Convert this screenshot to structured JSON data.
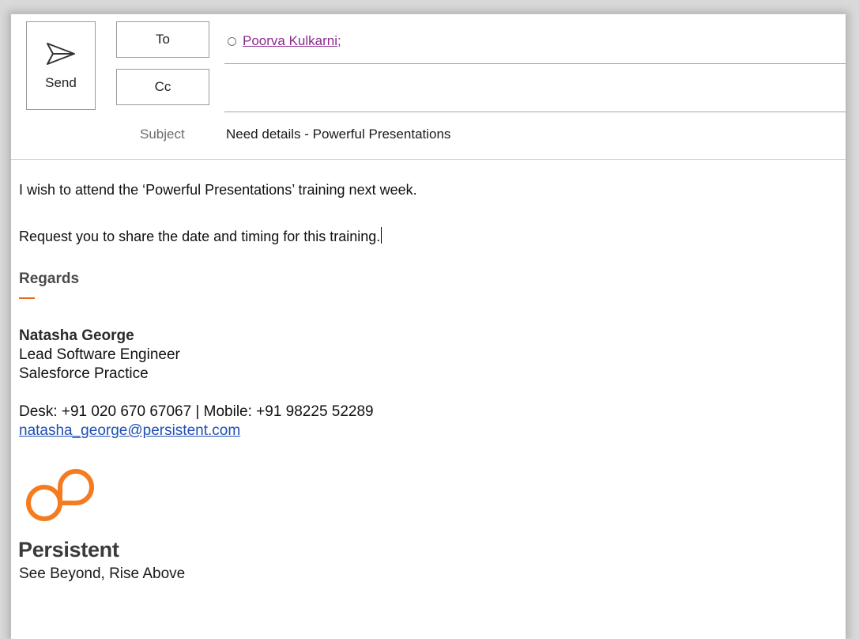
{
  "compose": {
    "send_label": "Send",
    "to_label": "To",
    "cc_label": "Cc",
    "recipient": "Poorva Kulkarni;",
    "cc_value": "",
    "subject_label": "Subject",
    "subject_value": "Need details - Powerful Presentations"
  },
  "body": {
    "line1": "I wish to attend the ‘Powerful Presentations’ training next week.",
    "line2": "Request you to share the date and timing for this training."
  },
  "signature": {
    "regards": "Regards",
    "name": "Natasha George",
    "title": "Lead Software Engineer",
    "department": "Salesforce Practice",
    "phones": "Desk: +91 020 670 67067 | Mobile: +91 98225 52289",
    "email": "natasha_george@persistent.com",
    "company": "Persistent",
    "tagline": "See Beyond, Rise Above"
  },
  "colors": {
    "accent": "#e86b1f",
    "link": "#1f4fb3",
    "recipient": "#8a2a8c"
  },
  "icons": {
    "send": "send-icon",
    "presence": "presence-icon",
    "logo": "persistent-logo"
  }
}
